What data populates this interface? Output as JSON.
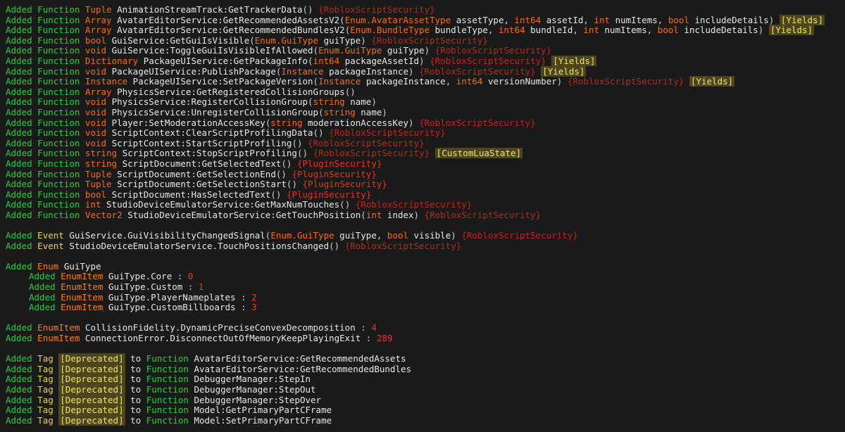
{
  "meta": {
    "title": "Roblox API Changelog",
    "background": "#1a1a1a",
    "colors": {
      "added": "#2ecc40",
      "function_keyword": "#21d53a",
      "event_tag_keyword": "#e8d44d",
      "enum_keyword": "#ff7f1a",
      "type": "#ff6a17",
      "identifier": "#e8e8e8",
      "number": "#e33a2e",
      "roblox_script_security": "#c2241b",
      "plugin_security": "#f22d22",
      "badge_background": "#4d4520",
      "badge_text": "#f2e45c"
    }
  },
  "lines": [
    {
      "kind": "function",
      "added": "Added",
      "keyword": "Function",
      "return_type": "Tuple",
      "name": "AnimationStreamTrack:GetTrackerData",
      "params": [],
      "security": "{RobloxScriptSecurity}",
      "security_class": "t-secr",
      "badges": []
    },
    {
      "kind": "function",
      "added": "Added",
      "keyword": "Function",
      "return_type": "Array",
      "name": "AvatarEditorService:GetRecommendedAssetsV2",
      "params": [
        {
          "type": "Enum.AvatarAssetType",
          "name": "assetType"
        },
        {
          "type": "int64",
          "name": "assetId"
        },
        {
          "type": "int",
          "name": "numItems"
        },
        {
          "type": "bool",
          "name": "includeDetails"
        }
      ],
      "security": "",
      "badges": [
        "[Yields]"
      ]
    },
    {
      "kind": "function",
      "added": "Added",
      "keyword": "Function",
      "return_type": "Array",
      "name": "AvatarEditorService:GetRecommendedBundlesV2",
      "params": [
        {
          "type": "Enum.BundleType",
          "name": "bundleType"
        },
        {
          "type": "int64",
          "name": "bundleId"
        },
        {
          "type": "int",
          "name": "numItems"
        },
        {
          "type": "bool",
          "name": "includeDetails"
        }
      ],
      "security": "",
      "badges": [
        "[Yields]"
      ]
    },
    {
      "kind": "function",
      "added": "Added",
      "keyword": "Function",
      "return_type": "bool",
      "name": "GuiService:GetGuiIsVisible",
      "params": [
        {
          "type": "Enum.GuiType",
          "name": "guiType"
        }
      ],
      "security": "{RobloxScriptSecurity}",
      "security_class": "t-secr",
      "badges": []
    },
    {
      "kind": "function",
      "added": "Added",
      "keyword": "Function",
      "return_type": "void",
      "name": "GuiService:ToggleGuiIsVisibleIfAllowed",
      "params": [
        {
          "type": "Enum.GuiType",
          "name": "guiType"
        }
      ],
      "security": "{RobloxScriptSecurity}",
      "security_class": "t-secr",
      "badges": []
    },
    {
      "kind": "function",
      "added": "Added",
      "keyword": "Function",
      "return_type": "Dictionary",
      "name": "PackageUIService:GetPackageInfo",
      "params": [
        {
          "type": "int64",
          "name": "packageAssetId"
        }
      ],
      "security": "{RobloxScriptSecurity}",
      "security_class": "t-secr",
      "badges": [
        "[Yields]"
      ]
    },
    {
      "kind": "function",
      "added": "Added",
      "keyword": "Function",
      "return_type": "void",
      "name": "PackageUIService:PublishPackage",
      "params": [
        {
          "type": "Instance",
          "name": "packageInstance"
        }
      ],
      "security": "{RobloxScriptSecurity}",
      "security_class": "t-secr",
      "badges": [
        "[Yields]"
      ]
    },
    {
      "kind": "function",
      "added": "Added",
      "keyword": "Function",
      "return_type": "Instance",
      "name": "PackageUIService:SetPackageVersion",
      "params": [
        {
          "type": "Instance",
          "name": "packageInstance"
        },
        {
          "type": "int64",
          "name": "versionNumber"
        }
      ],
      "security": "{RobloxScriptSecurity}",
      "security_class": "t-secr",
      "badges": [
        "[Yields]"
      ]
    },
    {
      "kind": "function",
      "added": "Added",
      "keyword": "Function",
      "return_type": "Array",
      "name": "PhysicsService:GetRegisteredCollisionGroups",
      "params": [],
      "security": "",
      "badges": []
    },
    {
      "kind": "function",
      "added": "Added",
      "keyword": "Function",
      "return_type": "void",
      "name": "PhysicsService:RegisterCollisionGroup",
      "params": [
        {
          "type": "string",
          "name": "name"
        }
      ],
      "security": "",
      "badges": []
    },
    {
      "kind": "function",
      "added": "Added",
      "keyword": "Function",
      "return_type": "void",
      "name": "PhysicsService:UnregisterCollisionGroup",
      "params": [
        {
          "type": "string",
          "name": "name"
        }
      ],
      "security": "",
      "badges": []
    },
    {
      "kind": "function",
      "added": "Added",
      "keyword": "Function",
      "return_type": "void",
      "name": "Player:SetModerationAccessKey",
      "params": [
        {
          "type": "string",
          "name": "moderationAccessKey"
        }
      ],
      "security": "{RobloxScriptSecurity}",
      "security_class": "t-secr",
      "badges": []
    },
    {
      "kind": "function",
      "added": "Added",
      "keyword": "Function",
      "return_type": "void",
      "name": "ScriptContext:ClearScriptProfilingData",
      "params": [],
      "security": "{RobloxScriptSecurity}",
      "security_class": "t-secr",
      "badges": []
    },
    {
      "kind": "function",
      "added": "Added",
      "keyword": "Function",
      "return_type": "void",
      "name": "ScriptContext:StartScriptProfiling",
      "params": [],
      "security": "{RobloxScriptSecurity}",
      "security_class": "t-secr",
      "badges": []
    },
    {
      "kind": "function",
      "added": "Added",
      "keyword": "Function",
      "return_type": "string",
      "name": "ScriptContext:StopScriptProfiling",
      "params": [],
      "security": "{RobloxScriptSecurity}",
      "security_class": "t-secr",
      "badges": [
        "[CustomLuaState]"
      ]
    },
    {
      "kind": "function",
      "added": "Added",
      "keyword": "Function",
      "return_type": "string",
      "name": "ScriptDocument:GetSelectedText",
      "params": [],
      "security": "{PluginSecurity}",
      "security_class": "t-secp",
      "badges": []
    },
    {
      "kind": "function",
      "added": "Added",
      "keyword": "Function",
      "return_type": "Tuple",
      "name": "ScriptDocument:GetSelectionEnd",
      "params": [],
      "security": "{PluginSecurity}",
      "security_class": "t-secp",
      "badges": []
    },
    {
      "kind": "function",
      "added": "Added",
      "keyword": "Function",
      "return_type": "Tuple",
      "name": "ScriptDocument:GetSelectionStart",
      "params": [],
      "security": "{PluginSecurity}",
      "security_class": "t-secp",
      "badges": []
    },
    {
      "kind": "function",
      "added": "Added",
      "keyword": "Function",
      "return_type": "bool",
      "name": "ScriptDocument:HasSelectedText",
      "params": [],
      "security": "{PluginSecurity}",
      "security_class": "t-secp",
      "badges": []
    },
    {
      "kind": "function",
      "added": "Added",
      "keyword": "Function",
      "return_type": "int",
      "name": "StudioDeviceEmulatorService:GetMaxNumTouches",
      "params": [],
      "security": "{RobloxScriptSecurity}",
      "security_class": "t-secr",
      "badges": []
    },
    {
      "kind": "function",
      "added": "Added",
      "keyword": "Function",
      "return_type": "Vector2",
      "name": "StudioDeviceEmulatorService:GetTouchPosition",
      "params": [
        {
          "type": "int",
          "name": "index"
        }
      ],
      "security": "{RobloxScriptSecurity}",
      "security_class": "t-secr",
      "badges": []
    },
    {
      "kind": "blank"
    },
    {
      "kind": "event",
      "added": "Added",
      "keyword": "Event",
      "name": "GuiService.GuiVisibilityChangedSignal",
      "params": [
        {
          "type": "Enum.GuiType",
          "name": "guiType"
        },
        {
          "type": "bool",
          "name": "visible"
        }
      ],
      "security": "{RobloxScriptSecurity}",
      "security_class": "t-secr",
      "badges": []
    },
    {
      "kind": "event",
      "added": "Added",
      "keyword": "Event",
      "name": "StudioDeviceEmulatorService.TouchPositionsChanged",
      "params": [],
      "security": "{RobloxScriptSecurity}",
      "security_class": "t-secr",
      "badges": []
    },
    {
      "kind": "blank"
    },
    {
      "kind": "enum",
      "added": "Added",
      "keyword": "Enum",
      "name": "GuiType",
      "indent": false
    },
    {
      "kind": "enumitem",
      "added": "Added",
      "keyword": "EnumItem",
      "name": "GuiType.Core",
      "value": "0",
      "indent": true
    },
    {
      "kind": "enumitem",
      "added": "Added",
      "keyword": "EnumItem",
      "name": "GuiType.Custom",
      "value": "1",
      "indent": true
    },
    {
      "kind": "enumitem",
      "added": "Added",
      "keyword": "EnumItem",
      "name": "GuiType.PlayerNameplates",
      "value": "2",
      "indent": true
    },
    {
      "kind": "enumitem",
      "added": "Added",
      "keyword": "EnumItem",
      "name": "GuiType.CustomBillboards",
      "value": "3",
      "indent": true
    },
    {
      "kind": "blank"
    },
    {
      "kind": "enumitem",
      "added": "Added",
      "keyword": "EnumItem",
      "name": "CollisionFidelity.DynamicPreciseConvexDecomposition",
      "value": "4",
      "indent": false
    },
    {
      "kind": "enumitem",
      "added": "Added",
      "keyword": "EnumItem",
      "name": "ConnectionError.DisconnectOutOfMemoryKeepPlayingExit",
      "value": "289",
      "indent": false
    },
    {
      "kind": "blank"
    },
    {
      "kind": "tag",
      "added": "Added",
      "keyword": "Tag",
      "tag_badge": "[Deprecated]",
      "to": "to",
      "target_kind": "Function",
      "name": "AvatarEditorService:GetRecommendedAssets"
    },
    {
      "kind": "tag",
      "added": "Added",
      "keyword": "Tag",
      "tag_badge": "[Deprecated]",
      "to": "to",
      "target_kind": "Function",
      "name": "AvatarEditorService:GetRecommendedBundles"
    },
    {
      "kind": "tag",
      "added": "Added",
      "keyword": "Tag",
      "tag_badge": "[Deprecated]",
      "to": "to",
      "target_kind": "Function",
      "name": "DebuggerManager:StepIn"
    },
    {
      "kind": "tag",
      "added": "Added",
      "keyword": "Tag",
      "tag_badge": "[Deprecated]",
      "to": "to",
      "target_kind": "Function",
      "name": "DebuggerManager:StepOut"
    },
    {
      "kind": "tag",
      "added": "Added",
      "keyword": "Tag",
      "tag_badge": "[Deprecated]",
      "to": "to",
      "target_kind": "Function",
      "name": "DebuggerManager:StepOver"
    },
    {
      "kind": "tag",
      "added": "Added",
      "keyword": "Tag",
      "tag_badge": "[Deprecated]",
      "to": "to",
      "target_kind": "Function",
      "name": "Model:GetPrimaryPartCFrame"
    },
    {
      "kind": "tag",
      "added": "Added",
      "keyword": "Tag",
      "tag_badge": "[Deprecated]",
      "to": "to",
      "target_kind": "Function",
      "name": "Model:SetPrimaryPartCFrame"
    }
  ]
}
